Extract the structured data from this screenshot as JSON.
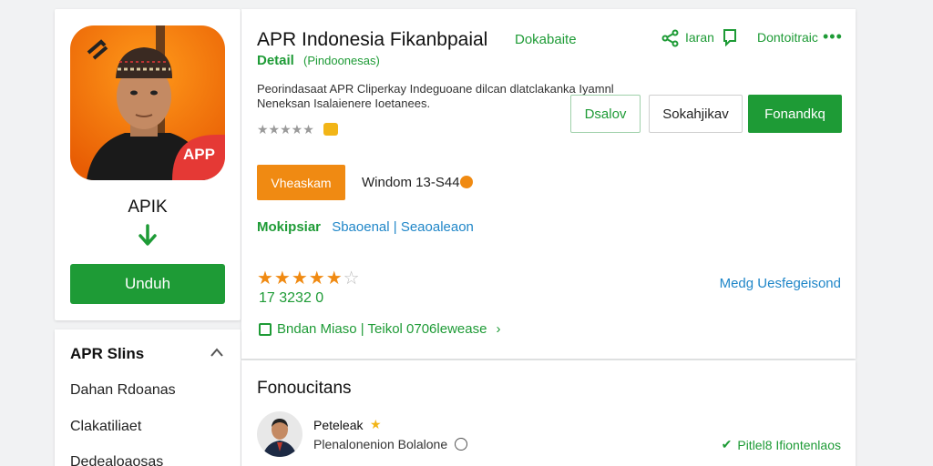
{
  "app": {
    "name": "APIK",
    "download_label": "Unduh",
    "icon_badge": "APP"
  },
  "categories": {
    "title": "APR Slins",
    "items": [
      "Dahan Rdoanas",
      "Clakatiliaet",
      "Dedealoaosas"
    ]
  },
  "header": {
    "title": "APR Indonesia Fikanbpaial",
    "title_sub": "Dokabaite",
    "detail_label": "Detail",
    "detail_sub": "(Pindoonesas)",
    "link_label": "Iaran",
    "contact_label": "Dontoitraic",
    "more_label": "•••"
  },
  "description": "Peorindasaat APR Cliperkay Indeguoane dilcan dlatclakanka Iyamnl Neneksan Isalaienere Ioetanees.",
  "mini_stars": "★★★★★",
  "buttons": {
    "details": "Dsalov",
    "share": "Sokahjikav",
    "install": "Fonandkq",
    "orange": "Vheaskam"
  },
  "platform_text": "Windom 13-S44",
  "category_line": {
    "primary": "Mokipsiar",
    "secondary": "Sbaoenal | Seaoaleaon"
  },
  "rating": {
    "stars_on": "★★★★★",
    "stars_off": "☆",
    "count": "17 3232 0",
    "review_link": "Medg Uesfegeisond"
  },
  "meta_line": "Bndan Miaso | Teikol 0706lewease",
  "meta_chevron": "›",
  "reviews": {
    "title": "Fonoucitans",
    "reviewer_name": "Peteleak",
    "reviewer_star": "★",
    "reviewer_sub": "Plenalonenion Bolalone",
    "verified_label": "Pitlel8 Ifiontenlaos",
    "verified_check": "✔"
  },
  "colors": {
    "accent_green": "#1e9b36",
    "accent_orange": "#f08a12",
    "link_blue": "#1f86c8"
  }
}
